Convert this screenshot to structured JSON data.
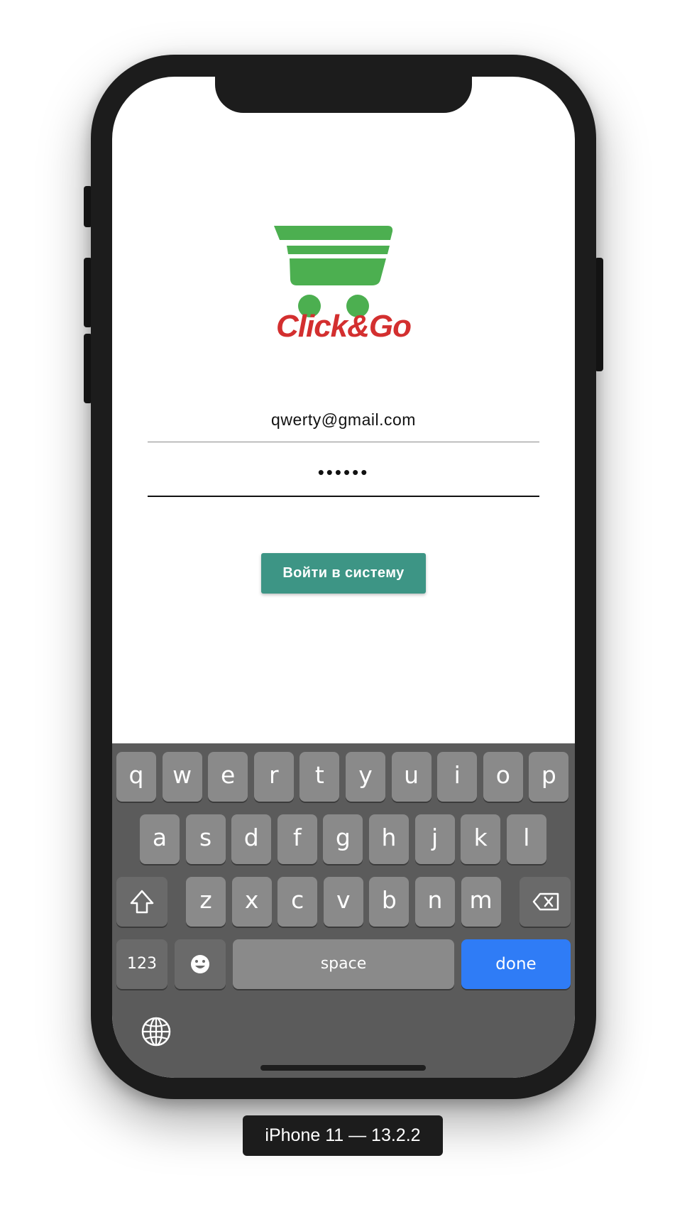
{
  "app": {
    "logo_text": "Click&Go",
    "brand_green": "#4caf50",
    "brand_red": "#d32f2f",
    "accent": "#3d9585"
  },
  "form": {
    "email_value": "qwerty@gmail.com",
    "password_value": "••••••",
    "login_label": "Войти в систему"
  },
  "keyboard": {
    "rows": [
      [
        "q",
        "w",
        "e",
        "r",
        "t",
        "y",
        "u",
        "i",
        "o",
        "p"
      ],
      [
        "a",
        "s",
        "d",
        "f",
        "g",
        "h",
        "j",
        "k",
        "l"
      ],
      [
        "z",
        "x",
        "c",
        "v",
        "b",
        "n",
        "m"
      ]
    ],
    "numbers_label": "123",
    "space_label": "space",
    "done_label": "done",
    "shift_icon": "shift-icon",
    "delete_icon": "backspace-icon",
    "emoji_icon": "emoji-icon",
    "globe_icon": "globe-icon",
    "done_color": "#2f7cf6"
  },
  "device": {
    "label": "iPhone 11 — 13.2.2"
  }
}
